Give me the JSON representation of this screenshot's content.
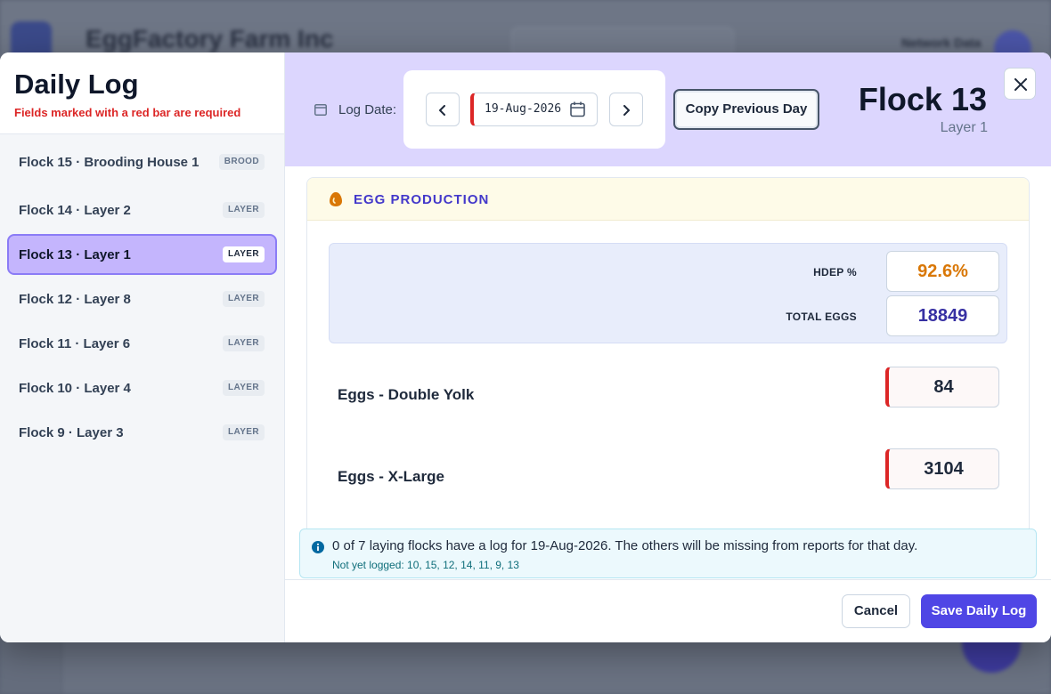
{
  "background": {
    "app_title": "EggFactory Farm Inc",
    "user_name": "Network Data"
  },
  "modal": {
    "title": "Daily Log",
    "required_note": "Fields marked with a red bar are required"
  },
  "flocks": [
    {
      "label": "Flock 15 · Brooding House 1",
      "badge": "BROOD",
      "active": false
    },
    {
      "label": "Flock 14 · Layer 2",
      "badge": "LAYER",
      "active": false
    },
    {
      "label": "Flock 13 · Layer 1",
      "badge": "LAYER",
      "active": true
    },
    {
      "label": "Flock 12 · Layer 8",
      "badge": "LAYER",
      "active": false
    },
    {
      "label": "Flock 11 · Layer 6",
      "badge": "LAYER",
      "active": false
    },
    {
      "label": "Flock 10 · Layer 4",
      "badge": "LAYER",
      "active": false
    },
    {
      "label": "Flock 9 · Layer 3",
      "badge": "LAYER",
      "active": false
    }
  ],
  "toolbar": {
    "log_date_label": "Log Date:",
    "date_value": "19-Aug-2026",
    "copy_label": "Copy Previous Day"
  },
  "header": {
    "flock_title": "Flock 13",
    "flock_subtitle": "Layer 1"
  },
  "section": {
    "title": "EGG PRODUCTION",
    "stats": [
      {
        "label": "HDEP %",
        "value": "92.6%",
        "color": "#d97706"
      },
      {
        "label": "TOTAL EGGS",
        "value": "18849",
        "color": "#3730a3"
      }
    ],
    "fields": [
      {
        "label": "Eggs - Double Yolk",
        "value": "84"
      },
      {
        "label": "Eggs - X-Large",
        "value": "3104"
      }
    ]
  },
  "info": {
    "message": "0 of 7 laying flocks have a log for 19-Aug-2026. The others will be missing from reports for that day.",
    "not_logged": "Not yet logged: 10, 15, 12, 14, 11, 9, 13"
  },
  "footer": {
    "cancel_label": "Cancel",
    "save_label": "Save Daily Log"
  },
  "colors": {
    "accent": "#4f46e5",
    "required": "#dc2626",
    "active_flock": "#c4b5fd",
    "header_bg": "#dcd6fe"
  }
}
